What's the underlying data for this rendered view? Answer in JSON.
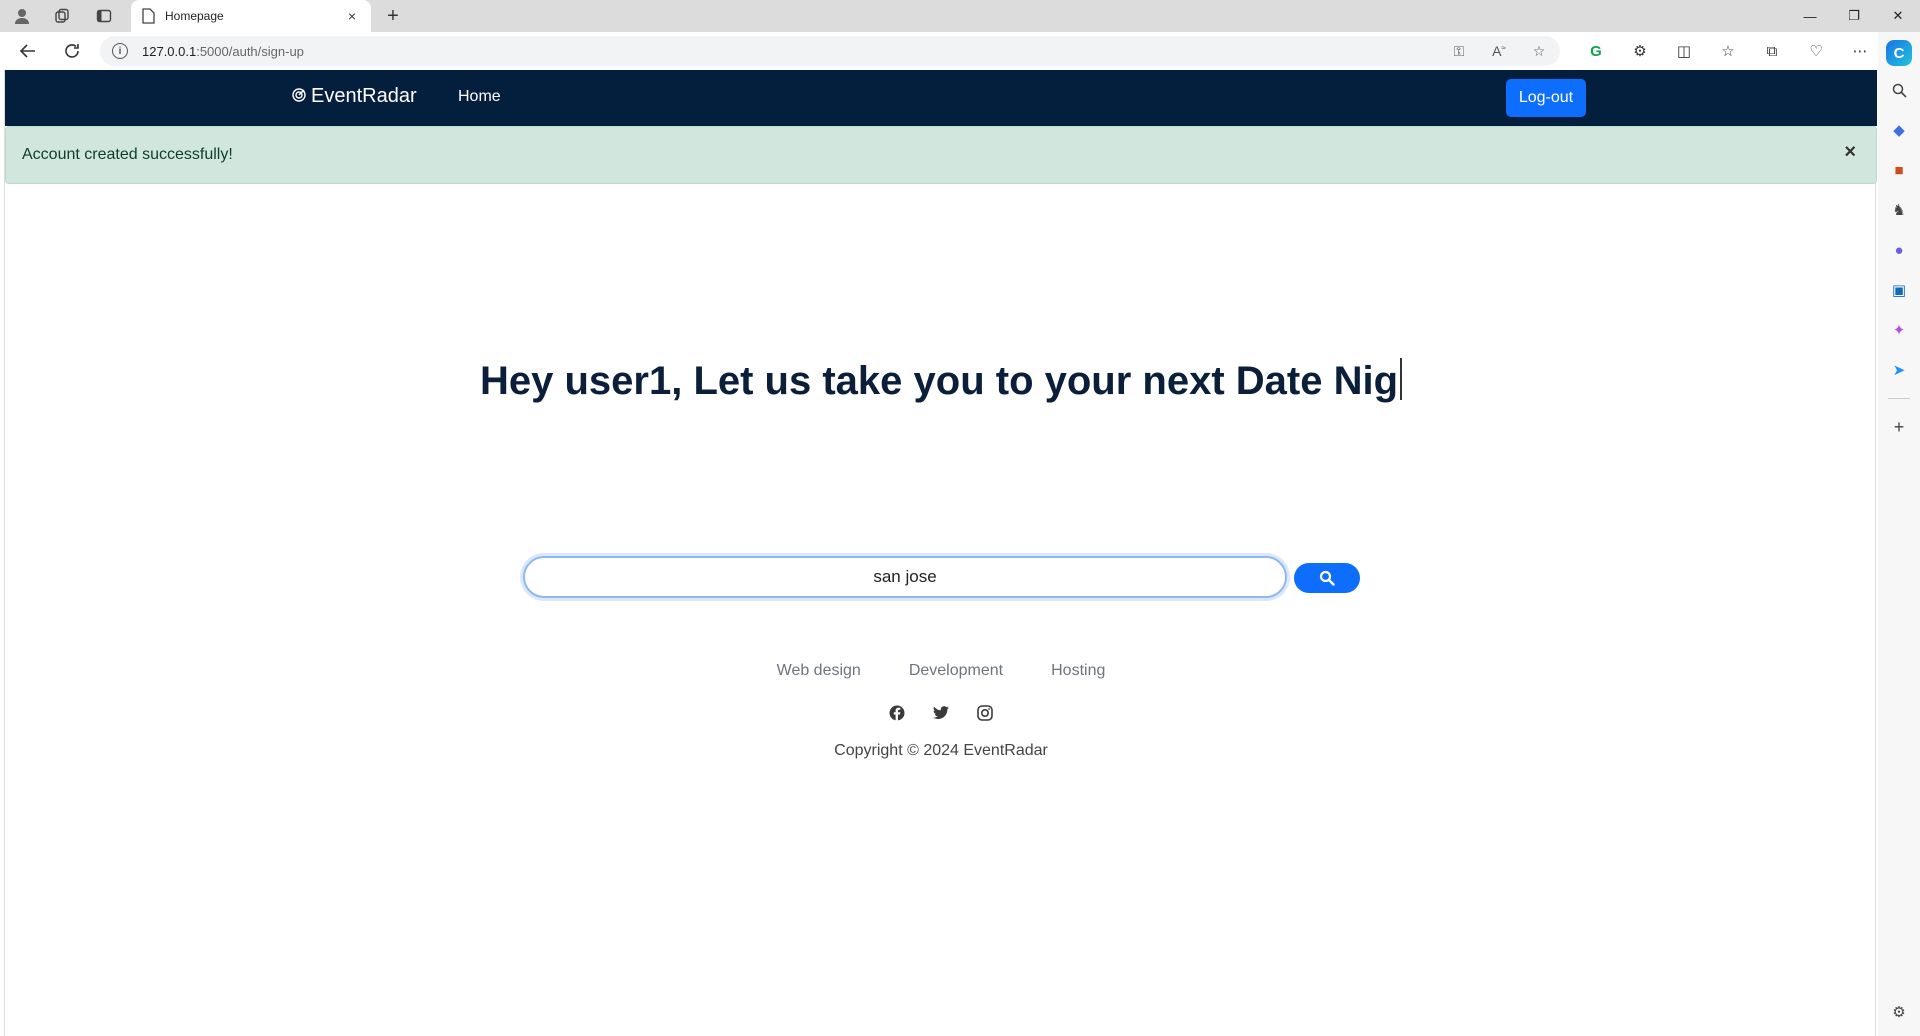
{
  "browser": {
    "tab_title": "Homepage",
    "tab_close": "×",
    "new_tab": "+",
    "url_host": "127.0.0.1",
    "url_rest": ":5000/auth/sign-up",
    "window_controls": [
      "—",
      "❐",
      "✕"
    ]
  },
  "navbar": {
    "brand_icon": "radar-icon",
    "brand": "EventRadar",
    "home": "Home",
    "logout": "Log-out",
    "bg_color": "#041e3d",
    "accent_color": "#0d6efd"
  },
  "alert": {
    "message": "Account created successfully!",
    "close": "×",
    "bg_color": "#d1e7dd"
  },
  "hero": {
    "title": "Hey user1, Let us take you to your next Date Nig"
  },
  "search": {
    "value": "san jose",
    "button_icon": "search-icon"
  },
  "footer": {
    "links": [
      "Web design",
      "Development",
      "Hosting"
    ],
    "socials": [
      "facebook-icon",
      "twitter-icon",
      "instagram-icon"
    ],
    "copyright": "Copyright © 2024 EventRadar"
  }
}
